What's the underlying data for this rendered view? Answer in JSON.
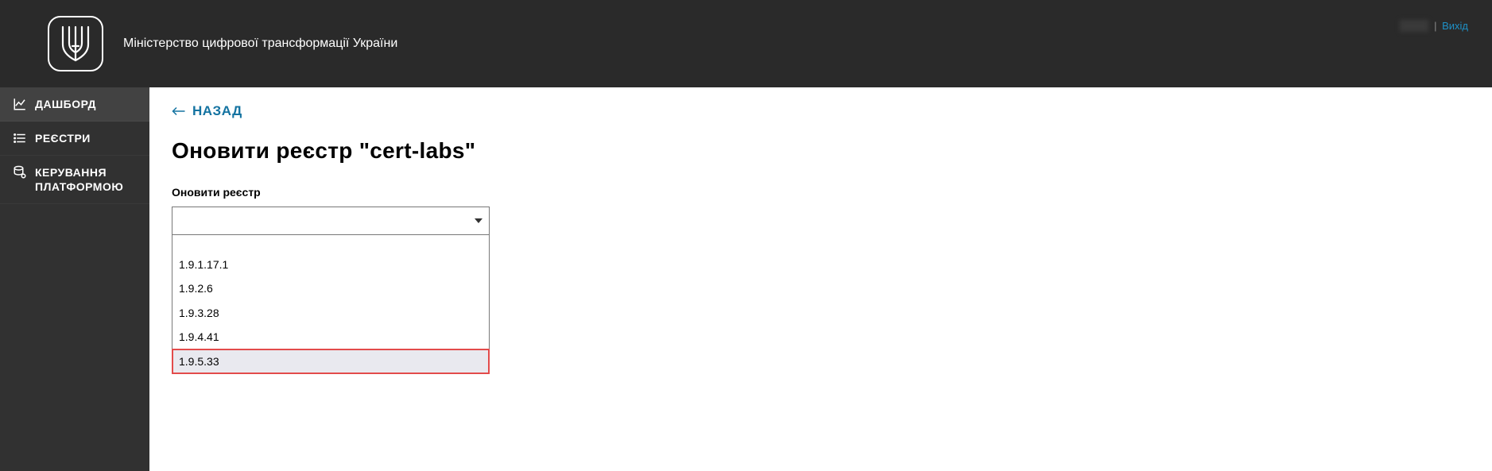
{
  "header": {
    "org_title": "Міністерство цифрової трансформації України",
    "user_name_blurred": "        ",
    "divider": "|",
    "logout": "Вихід"
  },
  "sidebar": {
    "items": [
      {
        "label": "ДАШБОРД"
      },
      {
        "label": "РЕЄСТРИ"
      },
      {
        "label": "КЕРУВАННЯ ПЛАТФОРМОЮ"
      }
    ]
  },
  "main": {
    "back_label": "НАЗАД",
    "page_title": "Оновити реєстр \"cert-labs\"",
    "field_label": "Оновити реєстр",
    "selected_value": "",
    "dropdown_options": [
      "",
      "1.9.1.17.1",
      "1.9.2.6",
      "1.9.3.28",
      "1.9.4.41",
      "1.9.5.33"
    ],
    "highlight_index": 5
  }
}
